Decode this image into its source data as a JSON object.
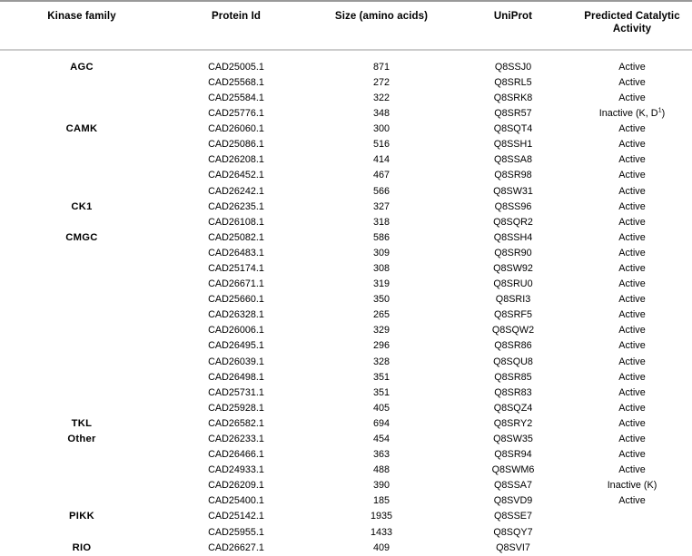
{
  "table": {
    "columns": [
      {
        "key": "family",
        "label": "Kinase family"
      },
      {
        "key": "protein",
        "label": "Protein Id"
      },
      {
        "key": "size",
        "label": "Size (amino acids)"
      },
      {
        "key": "uniprot",
        "label": "UniProt"
      },
      {
        "key": "activity",
        "label": "Predicted Catalytic Activity"
      }
    ],
    "rows": [
      {
        "family": "AGC",
        "protein": "CAD25005.1",
        "size": "871",
        "uniprot": "Q8SSJ0",
        "activity": "Active"
      },
      {
        "family": "",
        "protein": "CAD25568.1",
        "size": "272",
        "uniprot": "Q8SRL5",
        "activity": "Active"
      },
      {
        "family": "",
        "protein": "CAD25584.1",
        "size": "322",
        "uniprot": "Q8SRK8",
        "activity": "Active"
      },
      {
        "family": "",
        "protein": "CAD25776.1",
        "size": "348",
        "uniprot": "Q8SR57",
        "activity": "Inactive (K, D1)",
        "activity_base": "Inactive (K, D",
        "activity_sup": "1",
        "activity_tail": ")"
      },
      {
        "family": "CAMK",
        "protein": "CAD26060.1",
        "size": "300",
        "uniprot": "Q8SQT4",
        "activity": "Active"
      },
      {
        "family": "",
        "protein": "CAD25086.1",
        "size": "516",
        "uniprot": "Q8SSH1",
        "activity": "Active"
      },
      {
        "family": "",
        "protein": "CAD26208.1",
        "size": "414",
        "uniprot": "Q8SSA8",
        "activity": "Active"
      },
      {
        "family": "",
        "protein": "CAD26452.1",
        "size": "467",
        "uniprot": "Q8SR98",
        "activity": "Active"
      },
      {
        "family": "",
        "protein": "CAD26242.1",
        "size": "566",
        "uniprot": "Q8SW31",
        "activity": "Active"
      },
      {
        "family": "CK1",
        "protein": "CAD26235.1",
        "size": "327",
        "uniprot": "Q8SS96",
        "activity": "Active"
      },
      {
        "family": "",
        "protein": "CAD26108.1",
        "size": "318",
        "uniprot": "Q8SQR2",
        "activity": "Active"
      },
      {
        "family": "CMGC",
        "protein": "CAD25082.1",
        "size": "586",
        "uniprot": "Q8SSH4",
        "activity": "Active"
      },
      {
        "family": "",
        "protein": "CAD26483.1",
        "size": "309",
        "uniprot": "Q8SR90",
        "activity": "Active"
      },
      {
        "family": "",
        "protein": "CAD25174.1",
        "size": "308",
        "uniprot": "Q8SW92",
        "activity": "Active"
      },
      {
        "family": "",
        "protein": "CAD26671.1",
        "size": "319",
        "uniprot": "Q8SRU0",
        "activity": "Active"
      },
      {
        "family": "",
        "protein": "CAD25660.1",
        "size": "350",
        "uniprot": "Q8SRI3",
        "activity": "Active"
      },
      {
        "family": "",
        "protein": "CAD26328.1",
        "size": "265",
        "uniprot": "Q8SRF5",
        "activity": "Active"
      },
      {
        "family": "",
        "protein": "CAD26006.1",
        "size": "329",
        "uniprot": "Q8SQW2",
        "activity": "Active"
      },
      {
        "family": "",
        "protein": "CAD26495.1",
        "size": "296",
        "uniprot": "Q8SR86",
        "activity": "Active"
      },
      {
        "family": "",
        "protein": "CAD26039.1",
        "size": "328",
        "uniprot": "Q8SQU8",
        "activity": "Active"
      },
      {
        "family": "",
        "protein": "CAD26498.1",
        "size": "351",
        "uniprot": "Q8SR85",
        "activity": "Active"
      },
      {
        "family": "",
        "protein": "CAD25731.1",
        "size": "351",
        "uniprot": "Q8SR83",
        "activity": "Active"
      },
      {
        "family": "",
        "protein": "CAD25928.1",
        "size": "405",
        "uniprot": "Q8SQZ4",
        "activity": "Active"
      },
      {
        "family": "TKL",
        "protein": "CAD26582.1",
        "size": "694",
        "uniprot": "Q8SRY2",
        "activity": "Active"
      },
      {
        "family": "Other",
        "protein": "CAD26233.1",
        "size": "454",
        "uniprot": "Q8SW35",
        "activity": "Active"
      },
      {
        "family": "",
        "protein": "CAD26466.1",
        "size": "363",
        "uniprot": "Q8SR94",
        "activity": "Active"
      },
      {
        "family": "",
        "protein": "CAD24933.1",
        "size": "488",
        "uniprot": "Q8SWM6",
        "activity": "Active"
      },
      {
        "family": "",
        "protein": "CAD26209.1",
        "size": "390",
        "uniprot": "Q8SSA7",
        "activity": "Inactive (K)"
      },
      {
        "family": "",
        "protein": "CAD25400.1",
        "size": "185",
        "uniprot": "Q8SVD9",
        "activity": "Active"
      },
      {
        "family": "PIKK",
        "protein": "CAD25142.1",
        "size": "1935",
        "uniprot": "Q8SSE7",
        "activity": ""
      },
      {
        "family": "",
        "protein": "CAD25955.1",
        "size": "1433",
        "uniprot": "Q8SQY7",
        "activity": ""
      },
      {
        "family": "RIO",
        "protein": "CAD26627.1",
        "size": "409",
        "uniprot": "Q8SVI7",
        "activity": ""
      }
    ]
  },
  "style": {
    "rule_top_color": "#999999",
    "rule_bottom_color": "#cccccc",
    "text_color": "#000000",
    "background": "#ffffff"
  }
}
